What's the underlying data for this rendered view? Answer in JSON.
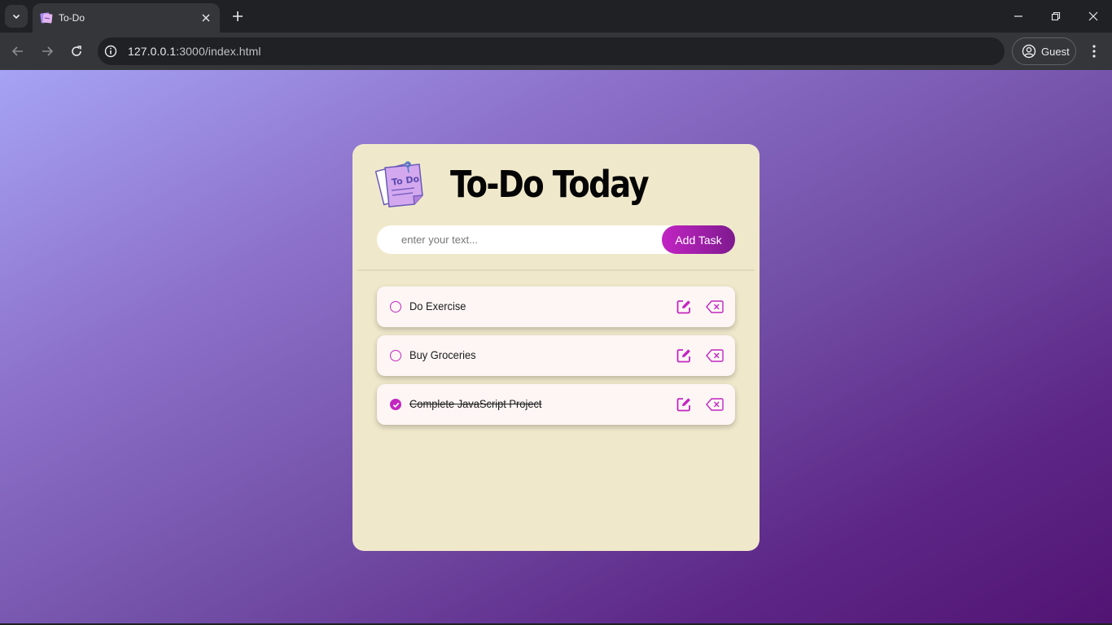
{
  "browser": {
    "tab_title": "To-Do",
    "url_host": "127.0.0.1",
    "url_path": ":3000/index.html",
    "profile_label": "Guest"
  },
  "app": {
    "title": "To-Do Today",
    "logo_text": "To Do",
    "input_placeholder": "enter your text...",
    "add_button_label": "Add Task",
    "accent_color": "#c224c3",
    "card_color": "#f0e8cb"
  },
  "tasks": [
    {
      "text": "Do Exercise",
      "completed": false
    },
    {
      "text": "Buy Groceries",
      "completed": false
    },
    {
      "text": "Complete JavaScript Project",
      "completed": true
    }
  ],
  "icons": {
    "task_edit": "pen-to-square-icon",
    "task_delete": "backspace-icon",
    "task_open": "circle-icon",
    "task_done": "circle-check-icon"
  }
}
